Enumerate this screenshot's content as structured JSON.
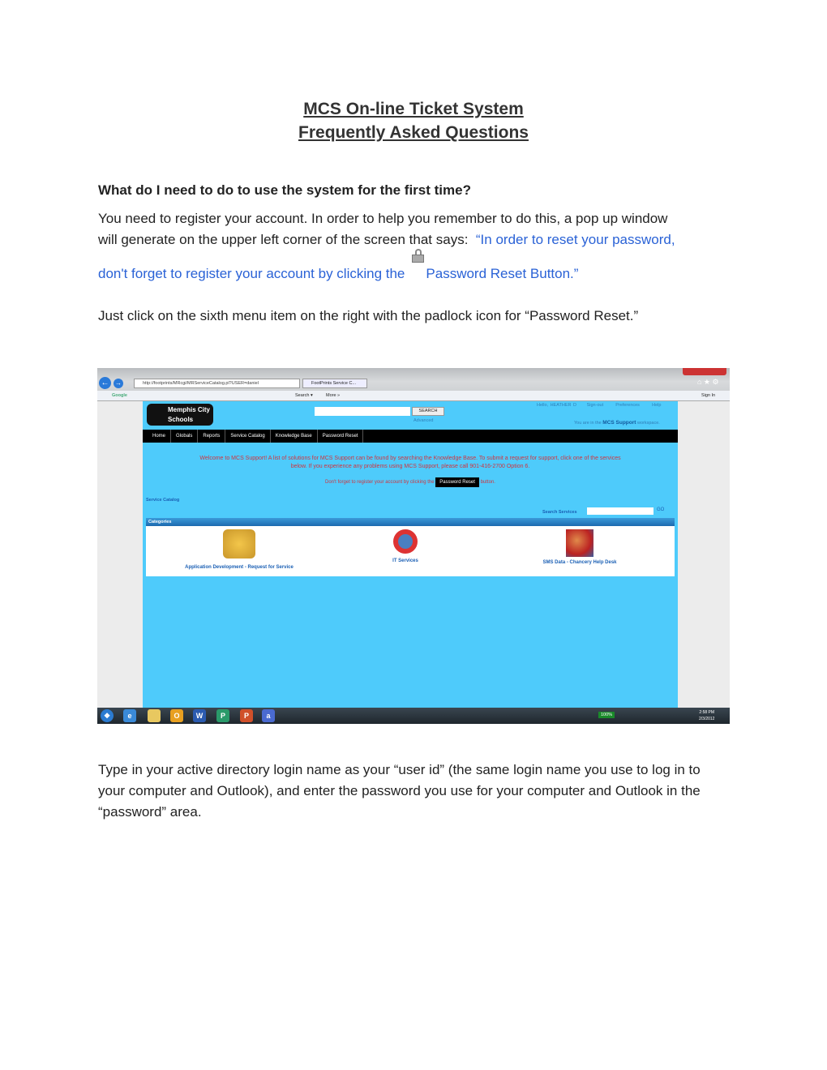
{
  "title_line1": "MCS On-line Ticket System",
  "title_line2": "Frequently Asked Questions",
  "question": "What do I need to do to use the system for the first time?",
  "para1_a": "You need to register your account. In order to help you remember to do this, a pop up window",
  "para1_b": "will generate on the upper left corner of the screen that says:",
  "para1_quote1": "“In order to reset your password,",
  "para1_quote2": "don't forget to register your account by clicking the",
  "para1_quote3": "Password Reset Button.”",
  "para2": "Just click on the sixth menu item on the right with the padlock icon for “Password Reset.”",
  "para3": "Type in your active directory login name as your “user id” (the same login name you use to log in to your computer and Outlook), and enter the password you use for your computer and Outlook in the “password” area.",
  "screenshot": {
    "url": "http://footprints/MRcgi/MRServiceCatalog.pl?USER=daniel",
    "tab": "FootPrints Service C...",
    "google_label": "Google",
    "search_label": "Search ▾",
    "more_label": "More »",
    "sign_in": "Sign In",
    "logo": "Memphis City Schools",
    "search_button": "SEARCH",
    "advanced": "Advanced",
    "hello": "Hello, HEATHER D",
    "signout": "Sign-out",
    "preferences": "Preferences",
    "help": "Help",
    "workspace_pre": "You are in the",
    "workspace_name": "MCS Support",
    "workspace_post": "workspace.",
    "menu": [
      "Home",
      "Globals",
      "Reports",
      "Service Catalog",
      "Knowledge Base",
      "Password Reset"
    ],
    "welcome": "Welcome to MCS Support! A list of solutions for MCS Support can be found by searching the Knowledge Base. To submit a request for support, click one of the services below.  If you experience any problems using MCS Support, please call 901-416-2700 Option 6.",
    "reminder_pre": "Don't forget to register your account by clicking the",
    "reminder_button": "Password Reset",
    "reminder_post": "button.",
    "service_catalog": "Service Catalog",
    "search_services": "Search Services",
    "go": "GO",
    "categories_header": "Categories",
    "categories": [
      "Application Development - Request for Service",
      "IT Services",
      "SMS Data - Chancery Help Desk"
    ],
    "battery": "100%",
    "time": "2:58 PM",
    "date": "2/3/2012"
  }
}
